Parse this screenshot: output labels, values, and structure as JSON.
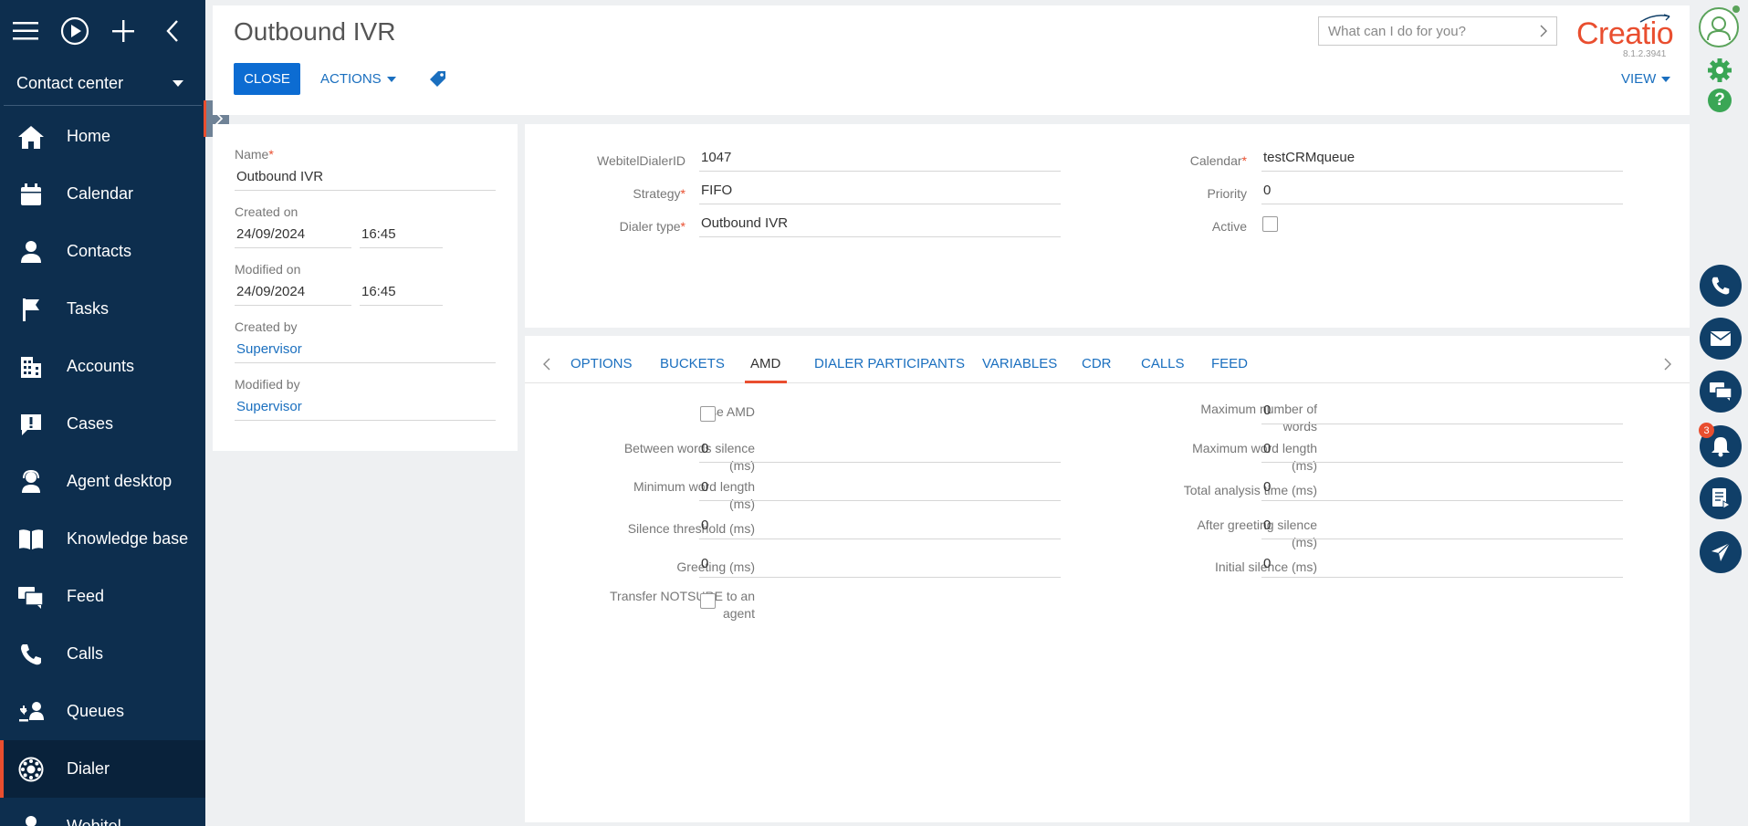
{
  "sidebar": {
    "workspace": "Contact center",
    "items": [
      {
        "label": "Home"
      },
      {
        "label": "Calendar"
      },
      {
        "label": "Contacts"
      },
      {
        "label": "Tasks"
      },
      {
        "label": "Accounts"
      },
      {
        "label": "Cases"
      },
      {
        "label": "Agent desktop"
      },
      {
        "label": "Knowledge base"
      },
      {
        "label": "Feed"
      },
      {
        "label": "Calls"
      },
      {
        "label": "Queues"
      },
      {
        "label": "Dialer"
      },
      {
        "label": "Webitel"
      }
    ],
    "active_item": "Dialer"
  },
  "header": {
    "title": "Outbound IVR",
    "close_label": "CLOSE",
    "actions_label": "ACTIONS",
    "view_label": "VIEW",
    "search_placeholder": "What can I do for you?",
    "logo": "Creatio",
    "version": "8.1.2.3941"
  },
  "info": {
    "name_label": "Name",
    "name_value": "Outbound IVR",
    "created_on_label": "Created on",
    "created_on_date": "24/09/2024",
    "created_on_time": "16:45",
    "modified_on_label": "Modified on",
    "modified_on_date": "24/09/2024",
    "modified_on_time": "16:45",
    "created_by_label": "Created by",
    "created_by_value": "Supervisor",
    "modified_by_label": "Modified by",
    "modified_by_value": "Supervisor"
  },
  "main": {
    "dialer_id_label": "WebitelDialerID",
    "dialer_id_value": "1047",
    "strategy_label": "Strategy",
    "strategy_value": "FIFO",
    "dialer_type_label": "Dialer type",
    "dialer_type_value": "Outbound IVR",
    "calendar_label": "Calendar",
    "calendar_value": "testCRMqueue",
    "priority_label": "Priority",
    "priority_value": "0",
    "active_label": "Active",
    "active_checked": false
  },
  "tabs": [
    "OPTIONS",
    "BUCKETS",
    "AMD",
    "DIALER PARTICIPANTS",
    "VARIABLES",
    "CDR",
    "CALLS",
    "FEED"
  ],
  "active_tab": "AMD",
  "amd": {
    "use_amd_label": "Use AMD",
    "between_words_label_1": "Between words silence",
    "between_words_label_2": "(ms)",
    "between_words_value": "0",
    "min_word_label_1": "Minimum word length",
    "min_word_label_2": "(ms)",
    "min_word_value": "0",
    "silence_threshold_label": "Silence threshold (ms)",
    "silence_threshold_value": "0",
    "greeting_label": "Greeting (ms)",
    "greeting_value": "0",
    "transfer_label_1": "Transfer NOTSURE to an",
    "transfer_label_2": "agent",
    "max_words_label_1": "Maximum number of",
    "max_words_label_2": "words",
    "max_words_value": "0",
    "max_word_len_label_1": "Maximum word length",
    "max_word_len_label_2": "(ms)",
    "max_word_len_value": "0",
    "total_analysis_label": "Total analysis time (ms)",
    "total_analysis_value": "0",
    "after_greeting_label_1": "After greeting silence",
    "after_greeting_label_2": "(ms)",
    "after_greeting_value": "0",
    "initial_silence_label": "Initial silence (ms)",
    "initial_silence_value": "0"
  },
  "notifications": {
    "count": "3"
  },
  "colors": {
    "sidebar": "#0d2e4e",
    "accent": "#e94e2f",
    "link": "#1a6fbf",
    "primary_button": "#0c6cd2",
    "settings_green": "#3aa655"
  }
}
